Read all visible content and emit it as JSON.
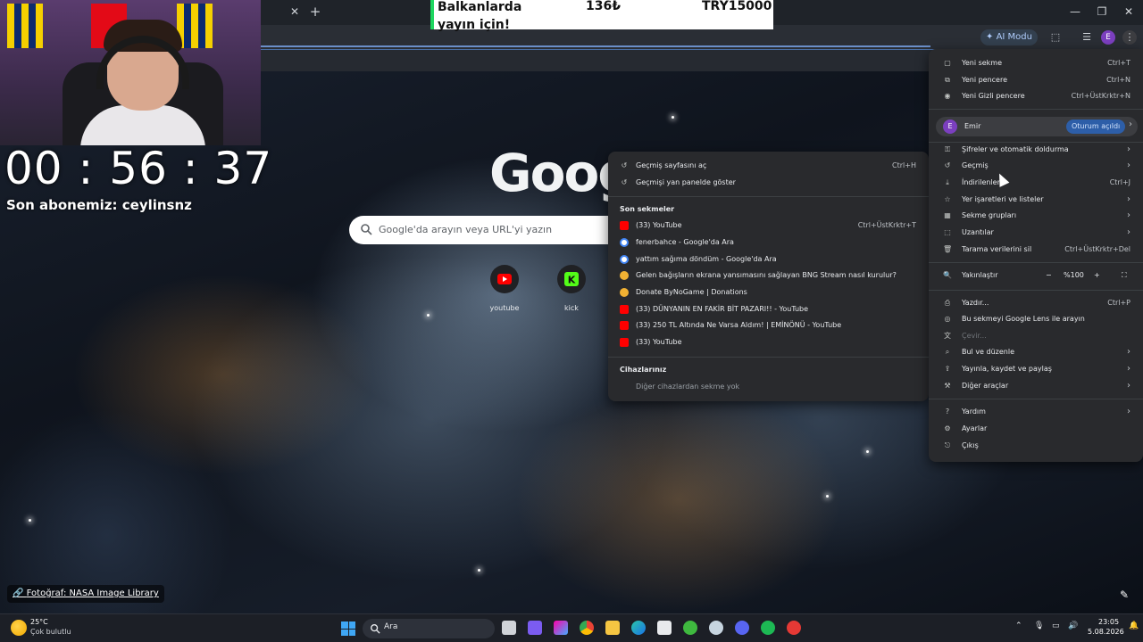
{
  "browser": {
    "ai_mode_label": "AI Modu",
    "avatar_letter": "E"
  },
  "donation": {
    "text": "Balkanlarda yayın için!",
    "amount": "136₺",
    "total": "TRY15000"
  },
  "stream": {
    "timer": "00 : 56 : 37",
    "subscriber": "Son abonemiz: ceylinsnz"
  },
  "newtab": {
    "logo": "Google",
    "search_placeholder": "Google'da arayın veya URL'yi yazın",
    "shortcuts": [
      {
        "label": "youtube",
        "color": "#ff0000"
      },
      {
        "label": "kick",
        "color": "#53fc18"
      }
    ],
    "photo_credit": "Fotoğraf: NASA Image Library"
  },
  "history_menu": {
    "top": [
      {
        "label": "Geçmiş sayfasını aç",
        "shortcut": "Ctrl+H"
      },
      {
        "label": "Geçmişi yan panelde göster",
        "shortcut": ""
      }
    ],
    "recent_title": "Son sekmeler",
    "recent": [
      {
        "label": "(33) YouTube",
        "shortcut": "Ctrl+ÜstKrktr+T",
        "icon": "youtube"
      },
      {
        "label": "fenerbahce - Google'da Ara",
        "shortcut": "",
        "icon": "google"
      },
      {
        "label": "yattım sağıma döndüm - Google'da Ara",
        "shortcut": "",
        "icon": "google"
      },
      {
        "label": "Gelen bağışların ekrana yansımasını sağlayan BNG Stream nasıl kurulur?",
        "shortcut": "",
        "icon": "bynogame"
      },
      {
        "label": "Donate ByNoGame | Donations",
        "shortcut": "",
        "icon": "bynogame"
      },
      {
        "label": "(33) DÜNYANIN EN FAKİR BİT PAZARI!! - YouTube",
        "shortcut": "",
        "icon": "youtube"
      },
      {
        "label": "(33) 250 TL Altında Ne Varsa Aldım! | EMİNÖNÜ - YouTube",
        "shortcut": "",
        "icon": "youtube"
      },
      {
        "label": "(33) YouTube",
        "shortcut": "",
        "icon": "youtube"
      }
    ],
    "devices_title": "Cihazlarınız",
    "devices_empty": "Diğer cihazlardan sekme yok"
  },
  "main_menu": {
    "new_items": [
      {
        "label": "Yeni sekme",
        "shortcut": "Ctrl+T"
      },
      {
        "label": "Yeni pencere",
        "shortcut": "Ctrl+N"
      },
      {
        "label": "Yeni Gizli pencere",
        "shortcut": "Ctrl+ÜstKrktr+N"
      }
    ],
    "profile": {
      "letter": "E",
      "name": "Emir",
      "status": "Oturum açıldı"
    },
    "section2": [
      {
        "label": "Şifreler ve otomatik doldurma",
        "shortcut": ""
      },
      {
        "label": "Geçmiş",
        "shortcut": ""
      },
      {
        "label": "İndirilenler",
        "shortcut": "Ctrl+J"
      },
      {
        "label": "Yer işaretleri ve listeler",
        "shortcut": ""
      },
      {
        "label": "Sekme grupları",
        "shortcut": ""
      },
      {
        "label": "Uzantılar",
        "shortcut": ""
      },
      {
        "label": "Tarama verilerini sil",
        "shortcut": "Ctrl+ÜstKrktr+Del"
      }
    ],
    "zoom": {
      "label": "Yakınlaştır",
      "minus": "−",
      "value": "%100",
      "plus": "+"
    },
    "section3": [
      {
        "label": "Yazdır...",
        "shortcut": "Ctrl+P"
      },
      {
        "label": "Bu sekmeyi Google Lens ile arayın",
        "shortcut": ""
      },
      {
        "label": "Çevir...",
        "shortcut": ""
      },
      {
        "label": "Bul ve düzenle",
        "shortcut": ""
      },
      {
        "label": "Yayınla, kaydet ve paylaş",
        "shortcut": ""
      },
      {
        "label": "Diğer araçlar",
        "shortcut": ""
      }
    ],
    "section4": [
      {
        "label": "Yardım",
        "shortcut": ""
      },
      {
        "label": "Ayarlar",
        "shortcut": ""
      },
      {
        "label": "Çıkış",
        "shortcut": ""
      }
    ]
  },
  "taskbar": {
    "weather_temp": "25°C",
    "weather_desc": "Çok bulutlu",
    "search_label": "Ara",
    "time": "23:05",
    "date": "5.08.2026"
  }
}
